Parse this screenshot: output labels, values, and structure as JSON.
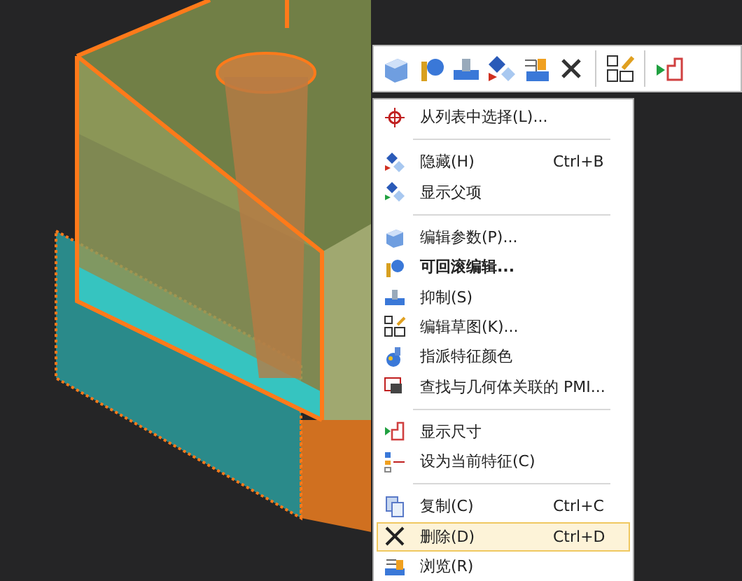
{
  "context_menu": {
    "items": [
      {
        "kind": "item",
        "label": "从列表中选择(L)...",
        "selected": false
      },
      {
        "kind": "separator"
      },
      {
        "kind": "item",
        "label": "隐藏(H)",
        "shortcut": "Ctrl+B",
        "selected": false
      },
      {
        "kind": "item",
        "label": "显示父项",
        "selected": false
      },
      {
        "kind": "separator"
      },
      {
        "kind": "item",
        "label": "编辑参数(P)...",
        "selected": false
      },
      {
        "kind": "item",
        "label": "可回滚编辑...",
        "bold": true,
        "selected": false
      },
      {
        "kind": "item",
        "label": "抑制(S)",
        "selected": false
      },
      {
        "kind": "item",
        "label": "编辑草图(K)...",
        "selected": false
      },
      {
        "kind": "item",
        "label": "指派特征颜色",
        "selected": false
      },
      {
        "kind": "item",
        "label": "查找与几何体关联的 PMI...",
        "selected": false
      },
      {
        "kind": "separator"
      },
      {
        "kind": "item",
        "label": "显示尺寸",
        "selected": false
      },
      {
        "kind": "item",
        "label": "设为当前特征(C)",
        "selected": false
      },
      {
        "kind": "separator"
      },
      {
        "kind": "item",
        "label": "复制(C)",
        "shortcut": "Ctrl+C",
        "selected": false
      },
      {
        "kind": "item",
        "label": "删除(D)",
        "shortcut": "Ctrl+D",
        "selected": true
      },
      {
        "kind": "item",
        "label": "浏览(R)",
        "selected": false
      }
    ]
  }
}
